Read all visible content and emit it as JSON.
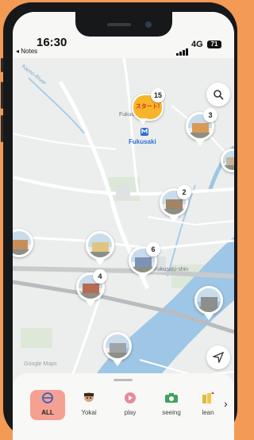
{
  "status": {
    "time": "16:30",
    "back_label": "◂ Notes",
    "network": "4G",
    "battery": "71"
  },
  "map": {
    "river_label": "Kamo-River",
    "area_labels": [
      "Fukuda",
      "Fukusaki-shin"
    ],
    "place_label": "Fukusaki",
    "watermark": "Google Maps",
    "start_label": "スタート!",
    "start_count": "15",
    "pin_counts": {
      "top_right": "3",
      "mid_right": "2",
      "center": "6",
      "left": "4"
    }
  },
  "categories": [
    {
      "label": "ALL",
      "active": true
    },
    {
      "label": "Yokai",
      "active": false
    },
    {
      "label": "play",
      "active": false
    },
    {
      "label": "seeing",
      "active": false
    },
    {
      "label": "lean",
      "active": false
    }
  ],
  "icons": {
    "search": "search-icon",
    "locate": "navigation-arrow-icon",
    "more": "chevron-right-icon"
  }
}
